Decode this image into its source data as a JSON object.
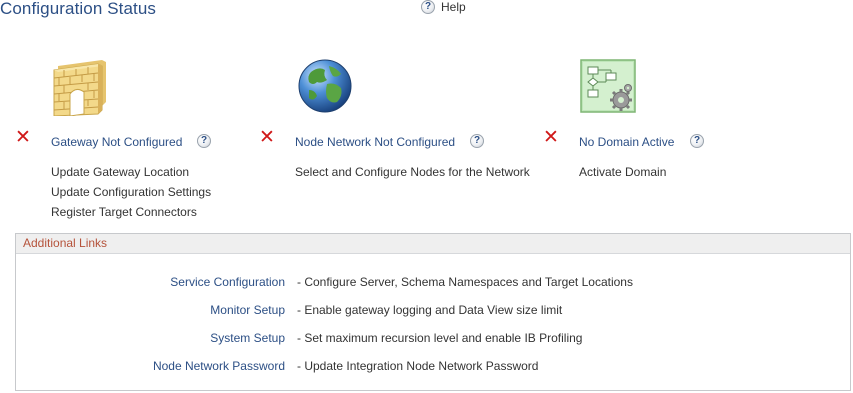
{
  "header": {
    "title": "Configuration Status",
    "help_label": "Help"
  },
  "status": [
    {
      "icon": "firewall-wall-icon",
      "state_icon": "red-x-icon",
      "title": "Gateway Not Configured",
      "actions": [
        "Update Gateway Location",
        "Update Configuration Settings",
        "Register Target Connectors"
      ]
    },
    {
      "icon": "globe-icon",
      "state_icon": "red-x-icon",
      "title": "Node Network Not Configured",
      "actions": [
        "Select and Configure Nodes for the Network"
      ]
    },
    {
      "icon": "domain-flowchart-icon",
      "state_icon": "red-x-icon",
      "title": "No Domain Active",
      "actions": [
        "Activate Domain"
      ]
    }
  ],
  "additional_links": {
    "header": "Additional Links",
    "items": [
      {
        "label": "Service Configuration",
        "desc": "- Configure Server, Schema Namespaces and Target Locations"
      },
      {
        "label": "Monitor Setup",
        "desc": "- Enable gateway logging and Data View size limit"
      },
      {
        "label": "System Setup",
        "desc": "- Set maximum recursion level and enable IB Profiling"
      },
      {
        "label": "Node Network Password",
        "desc": "- Update Integration Node Network Password"
      }
    ]
  },
  "colors": {
    "title": "#2c4f85",
    "link": "#2c4f85",
    "error_x": "#d01818",
    "panel_header_text": "#b5523a",
    "panel_header_bg": "#efefef"
  }
}
